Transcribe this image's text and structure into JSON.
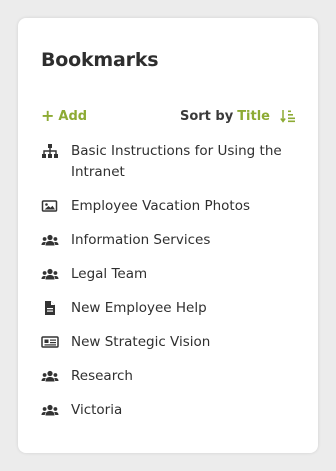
{
  "bookmarks": {
    "title": "Bookmarks",
    "add_label": "Add",
    "sort_prefix": "Sort by",
    "sort_field": "Title",
    "accent_color": "#8dab34",
    "items": [
      {
        "label": "Basic Instructions for Using the Intranet",
        "icon": "sitemap-icon"
      },
      {
        "label": "Employee Vacation Photos",
        "icon": "image-icon"
      },
      {
        "label": "Information Services",
        "icon": "users-icon"
      },
      {
        "label": "Legal Team",
        "icon": "users-icon"
      },
      {
        "label": "New Employee Help",
        "icon": "document-icon"
      },
      {
        "label": "New Strategic Vision",
        "icon": "newspaper-icon"
      },
      {
        "label": "Research",
        "icon": "users-icon"
      },
      {
        "label": "Victoria",
        "icon": "users-icon"
      }
    ]
  }
}
